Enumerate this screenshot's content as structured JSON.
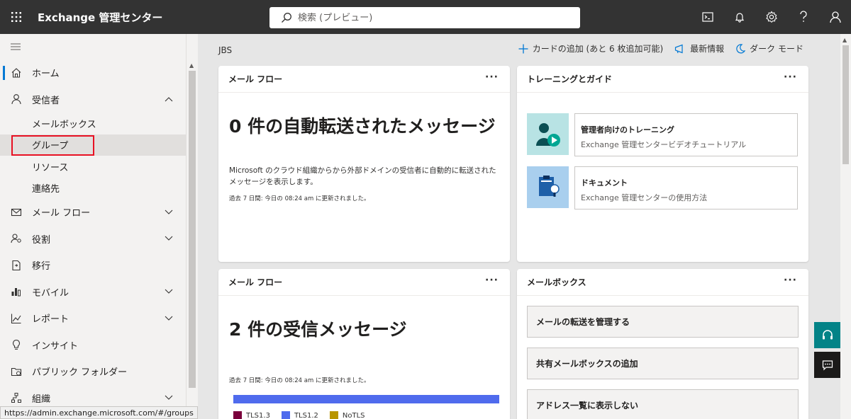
{
  "app": {
    "title": "Exchange 管理センター"
  },
  "search": {
    "placeholder": "検索 (プレビュー)"
  },
  "nav": {
    "home": "ホーム",
    "recipients": "受信者",
    "recipients_sub": [
      "メールボックス",
      "グループ",
      "リソース",
      "連絡先"
    ],
    "mail_flow": "メール フロー",
    "roles": "役割",
    "migration": "移行",
    "mobile": "モバイル",
    "reports": "レポート",
    "insights": "インサイト",
    "public_folders": "パブリック フォルダー",
    "organization": "組織"
  },
  "header": {
    "org": "JBS",
    "add_card": "カードの追加 (あと 6 枚追加可能)",
    "whats_new": "最新情報",
    "dark_mode": "ダーク モード"
  },
  "cards": {
    "mailflow1": {
      "title": "メール フロー",
      "more": "···",
      "headline": "0 件の自動転送されたメッセージ",
      "description": "Microsoft のクラウド組織からから外部ドメインの受信者に自動的に転送されたメッセージを表示します。",
      "updated": "過去 7 日間: 今日の 08:24 am に更新されました。"
    },
    "training": {
      "title": "トレーニングとガイド",
      "more": "···",
      "items": [
        {
          "title": "管理者向けのトレーニング",
          "subtitle": "Exchange 管理センタービデオチュートリアル"
        },
        {
          "title": "ドキュメント",
          "subtitle": "Exchange 管理センターの使用方法"
        }
      ]
    },
    "mailflow2": {
      "title": "メール フロー",
      "more": "···",
      "headline": "2 件の受信メッセージ",
      "updated": "過去 7 日間: 今日の 08:24 am に更新されました。",
      "legend": [
        "TLS1.3",
        "TLS1.2",
        "NoTLS"
      ]
    },
    "mailbox": {
      "title": "メールボックス",
      "more": "···",
      "buttons": [
        "メールの転送を管理する",
        "共有メールボックスの追加",
        "アドレス一覧に表示しない"
      ]
    }
  },
  "colors": {
    "topbar": "#333333",
    "accent": "#0078d4",
    "highlight": "#e81123",
    "tls13": "#7a003c",
    "tls12": "#4f6bed",
    "notls": "#b89500",
    "float_btn_teal": "#038387",
    "float_btn_dark": "#1b1a19"
  },
  "status_url": "https://admin.exchange.microsoft.com/#/groups"
}
